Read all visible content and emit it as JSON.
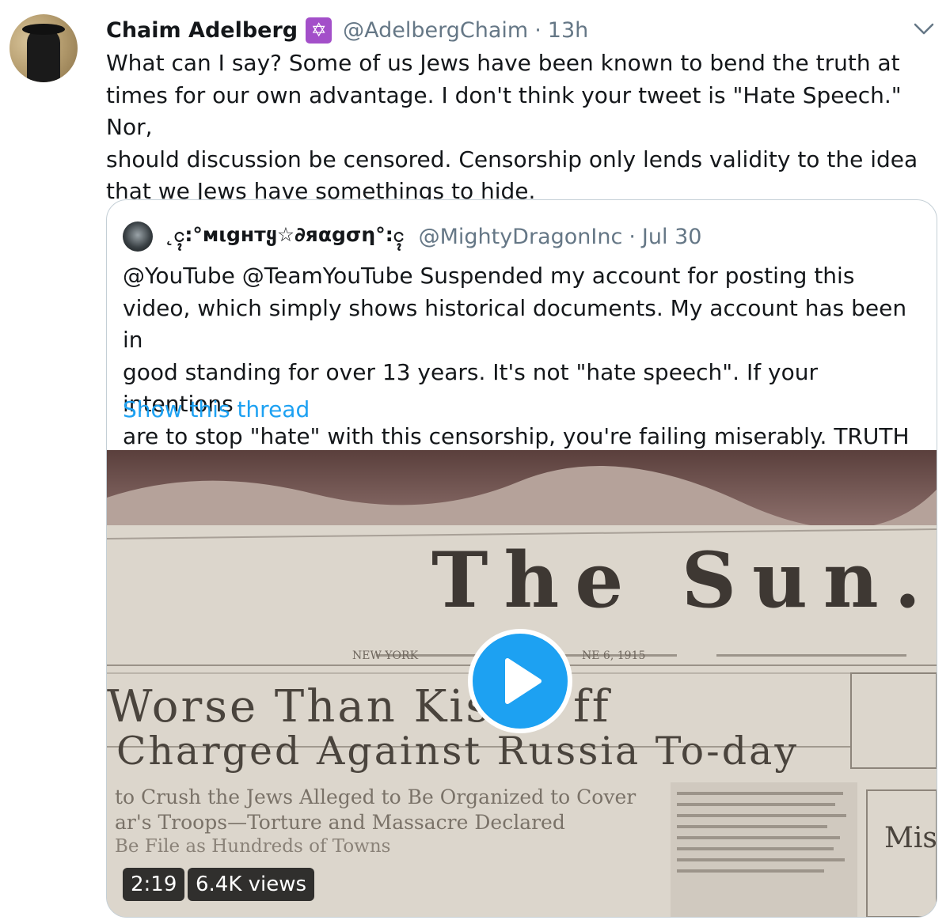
{
  "tweet": {
    "author_name": "Chaim Adelberg",
    "badge_glyph": "✡",
    "handle": "@AdelbergChaim",
    "separator": "·",
    "time": "13h",
    "text": "What can I say?  Some of us Jews have been known to bend the truth at\ntimes for our own advantage.  I don't think your tweet is \"Hate Speech.\" Nor,\nshould discussion  be censored. Censorship only lends validity to the idea\nthat we Jews have somethings to hide."
  },
  "quoted": {
    "author_name": "˛ၚ:°мιgнтყ☆∂яαgση°:ၚ",
    "handle": "@MightyDragonInc",
    "separator": "·",
    "time": "Jul 30",
    "text": "@YouTube @TeamYouTube Suspended my account for posting this\nvideo, which simply shows historical documents. My account has been in\ngood standing for over 13 years. It's not \"hate speech\". If your intentions\nare to stop \"hate\" with this censorship, you're failing miserably. TRUTH",
    "thread_link": "Show this thread",
    "video": {
      "duration": "2:19",
      "views": "6.4K views",
      "newspaper": {
        "masthead": "The Sun.",
        "dateline_left": "NEW YORK",
        "dateline_right": "NE 6, 1915",
        "headline_1": "Worse Than Kis     ff",
        "headline_2": "Charged Against Russia To-day",
        "sub_1": "to Crush the Jews Alleged to Be Organized to Cover",
        "sub_2": "ar's Troops—Torture and Massacre Declared",
        "sub_3": "Be File as Hundreds of Towns",
        "side_box": "Mis"
      }
    }
  },
  "colors": {
    "accent": "#1da1f2",
    "muted": "#657786",
    "badge": "#a34fc9"
  }
}
